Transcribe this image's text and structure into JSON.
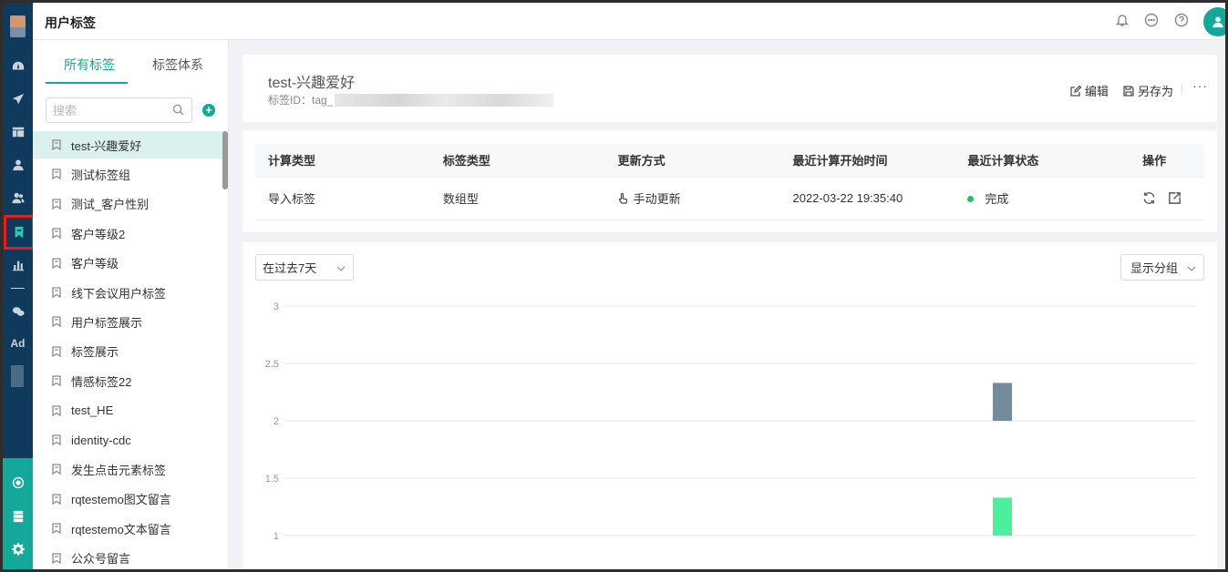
{
  "header": {
    "title": "用户标签"
  },
  "rail": {
    "ad_label": "Ad"
  },
  "panel": {
    "tabs": [
      {
        "label": "所有标签"
      },
      {
        "label": "标签体系"
      }
    ],
    "search_placeholder": "搜索",
    "add_label": "+",
    "items": [
      {
        "label": "test-兴趣爱好"
      },
      {
        "label": "测试标签组"
      },
      {
        "label": "测试_客户性别"
      },
      {
        "label": "客户等级2"
      },
      {
        "label": "客户等级"
      },
      {
        "label": "线下会议用户标签"
      },
      {
        "label": "用户标签展示"
      },
      {
        "label": "标签展示"
      },
      {
        "label": "情感标签22"
      },
      {
        "label": "test_HE"
      },
      {
        "label": "identity-cdc"
      },
      {
        "label": "发生点击元素标签"
      },
      {
        "label": "rqtestemo图文留言"
      },
      {
        "label": "rqtestemo文本留言"
      },
      {
        "label": "公众号留言"
      }
    ]
  },
  "detail": {
    "title": "test-兴趣爱好",
    "id_label": "标签ID：",
    "id_value": "tag_",
    "edit_label": "编辑",
    "save_as_label": "另存为",
    "more_label": "···"
  },
  "meta_table": {
    "headers": [
      "计算类型",
      "标签类型",
      "更新方式",
      "最近计算开始时间",
      "最近计算状态",
      "操作"
    ],
    "row": {
      "calc_type": "导入标签",
      "tag_type": "数组型",
      "update_mode": "手动更新",
      "last_start": "2022-03-22 19:35:40",
      "status": "完成"
    }
  },
  "chart_controls": {
    "range_select": "在过去7天",
    "group_select": "显示分组"
  },
  "chart_data": {
    "type": "bar",
    "title": "",
    "xlabel": "",
    "ylabel": "",
    "y_ticks": [
      "3",
      "2.5",
      "2",
      "1.5",
      "1"
    ],
    "ylim": [
      1,
      3
    ],
    "grid": true,
    "bars": [
      {
        "category_index": 0,
        "y_base": 2,
        "value": 2.33,
        "color": "#728c9c"
      },
      {
        "category_index": 0,
        "y_base": 1,
        "value": 1.33,
        "color": "#4cf09c"
      }
    ]
  },
  "colors": {
    "accent": "#14a89a",
    "rail": "#0f3a5c",
    "status_ok": "#23c16b"
  }
}
